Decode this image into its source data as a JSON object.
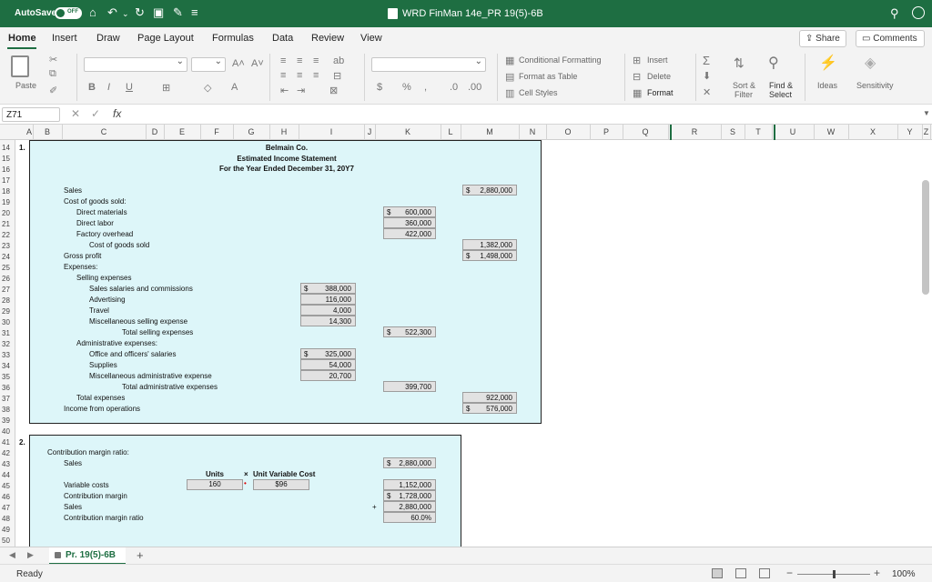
{
  "titlebar": {
    "autosave_label": "AutoSave",
    "autosave_state": "OFF",
    "doc_title": "WRD FinMan 14e_PR 19(5)-6B",
    "icons": [
      "home-icon",
      "undo-icon",
      "redo-icon",
      "save-icon",
      "customize-icon",
      "search-icon",
      "feedback-icon"
    ]
  },
  "menu": {
    "tabs": [
      "Home",
      "Insert",
      "Draw",
      "Page Layout",
      "Formulas",
      "Data",
      "Review",
      "View"
    ],
    "share": "Share",
    "comments": "Comments"
  },
  "ribbon": {
    "paste": "Paste",
    "conditional_formatting": "Conditional Formatting",
    "format_as_table": "Format as Table",
    "cell_styles": "Cell Styles",
    "insert": "Insert",
    "delete": "Delete",
    "format": "Format",
    "sort_filter_1": "Sort &",
    "sort_filter_2": "Filter",
    "find_select_1": "Find &",
    "find_select_2": "Select",
    "ideas": "Ideas",
    "sensitivity": "Sensitivity"
  },
  "formula_bar": {
    "name_box": "Z71",
    "fx": "fx",
    "content": ""
  },
  "columns": [
    "A",
    "B",
    "C",
    "D",
    "E",
    "F",
    "G",
    "H",
    "I",
    "J",
    "K",
    "L",
    "M",
    "N",
    "O",
    "P",
    "Q",
    "R",
    "S",
    "T",
    "U",
    "W",
    "X",
    "Y",
    "Z"
  ],
  "rows": [
    "14",
    "15",
    "16",
    "17",
    "18",
    "19",
    "20",
    "21",
    "22",
    "23",
    "24",
    "25",
    "26",
    "27",
    "28",
    "29",
    "30",
    "31",
    "32",
    "33",
    "34",
    "35",
    "36",
    "37",
    "38",
    "39",
    "40",
    "41",
    "42",
    "43",
    "44",
    "45",
    "46",
    "47",
    "48",
    "49",
    "50"
  ],
  "sheet": {
    "part1": {
      "num": "1.",
      "company": "Belmain Co.",
      "title": "Estimated Income Statement",
      "period": "For the Year Ended December 31, 20Y7",
      "sales_label": "Sales",
      "sales_dollar": "$",
      "sales_value": "2,880,000",
      "cogs_header": "Cost of goods sold:",
      "dm_label": "Direct materials",
      "dm_dollar": "$",
      "dm_value": "600,000",
      "dl_label": "Direct labor",
      "dl_value": "360,000",
      "foh_label": "Factory overhead",
      "foh_value": "422,000",
      "cogs_label": "Cost of goods sold",
      "cogs_value": "1,382,000",
      "gp_label": "Gross profit",
      "gp_dollar": "$",
      "gp_value": "1,498,000",
      "exp_header": "Expenses:",
      "sell_header": "Selling expenses",
      "ssc_label": "Sales salaries and commissions",
      "ssc_dollar": "$",
      "ssc_value": "388,000",
      "adv_label": "Advertising",
      "adv_value": "116,000",
      "trv_label": "Travel",
      "trv_value": "4,000",
      "mse_label": "Miscellaneous selling expense",
      "mse_value": "14,300",
      "tse_label": "Total selling expenses",
      "tse_dollar": "$",
      "tse_value": "522,300",
      "adm_header": "Administrative expenses:",
      "oos_label": "Office and officers' salaries",
      "oos_dollar": "$",
      "oos_value": "325,000",
      "sup_label": "Supplies",
      "sup_value": "54,000",
      "mae_label": "Miscellaneous administrative expense",
      "mae_value": "20,700",
      "tae_label": "Total administrative expenses",
      "tae_value": "399,700",
      "te_label": "Total expenses",
      "te_value": "922,000",
      "io_label": "Income from operations",
      "io_dollar": "$",
      "io_value": "576,000"
    },
    "part2": {
      "num": "2.",
      "cmr_header": "Contribution margin ratio:",
      "sales_label": "Sales",
      "sales_dollar": "$",
      "sales_value": "2,880,000",
      "units_header": "Units",
      "times": "×",
      "uvc_header": "Unit Variable Cost",
      "units_value": "160",
      "uvc_value": "$96",
      "vc_label": "Variable costs",
      "vc_value": "1,152,000",
      "cm_label": "Contribution margin",
      "cm_dollar": "$",
      "cm_value": "1,728,000",
      "sales2_label": "Sales",
      "plus": "+",
      "sales2_value": "2,880,000",
      "cmr_label": "Contribution margin ratio",
      "cmr_value": "60.0%"
    }
  },
  "tabs": {
    "sheet_name": "Pr. 19(5)-6B",
    "add": "+"
  },
  "status": {
    "ready": "Ready",
    "zoom": "100%",
    "zoom_fraction": 0.5
  }
}
